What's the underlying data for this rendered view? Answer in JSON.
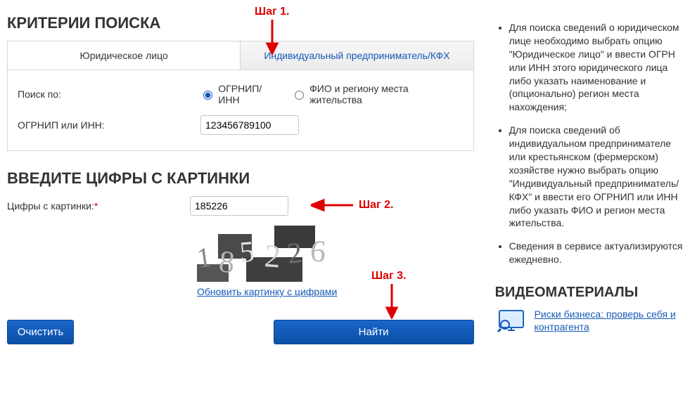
{
  "search": {
    "title": "КРИТЕРИИ ПОИСКА",
    "tab_legal": "Юридическое лицо",
    "tab_ip": "Индивидуальный предприниматель/КФХ",
    "label_search_by": "Поиск по:",
    "radio_ogrnip": "ОГРНИП/ИНН",
    "radio_fio": "ФИО и региону места жительства",
    "label_ogrnip": "ОГРНИП или ИНН:",
    "ogrnip_value": "123456789100"
  },
  "captcha": {
    "title": "ВВЕДИТЕ ЦИФРЫ С КАРТИНКИ",
    "label": "Цифры с картинки:",
    "value": "185226",
    "refresh": "Обновить картинку с цифрами",
    "image_text": "185226"
  },
  "buttons": {
    "clear": "Очистить",
    "find": "Найти"
  },
  "right": {
    "bullets": [
      "Для поиска сведений о юридическом лице необходимо выбрать опцию \"Юридическое лицо\" и ввести ОГРН или ИНН этого юридического лица либо указать наименование и (опционально) регион места нахождения;",
      "Для поиска сведений об индивидуальном предпринимателе или крестьянском (фермерском) хозяйстве нужно выбрать опцию \"Индивидуальный предприниматель/КФХ\" и ввести его ОГРНИП или ИНН либо указать ФИО и регион места жительства.",
      "Сведения в сервисе актуализируются ежедневно."
    ],
    "video_title": "ВИДЕОМАТЕРИАЛЫ",
    "video_link": "Риски бизнеса: проверь себя и контрагента"
  },
  "annotations": {
    "step1": "Шаг 1.",
    "step2": "Шаг 2.",
    "step3": "Шаг 3."
  }
}
